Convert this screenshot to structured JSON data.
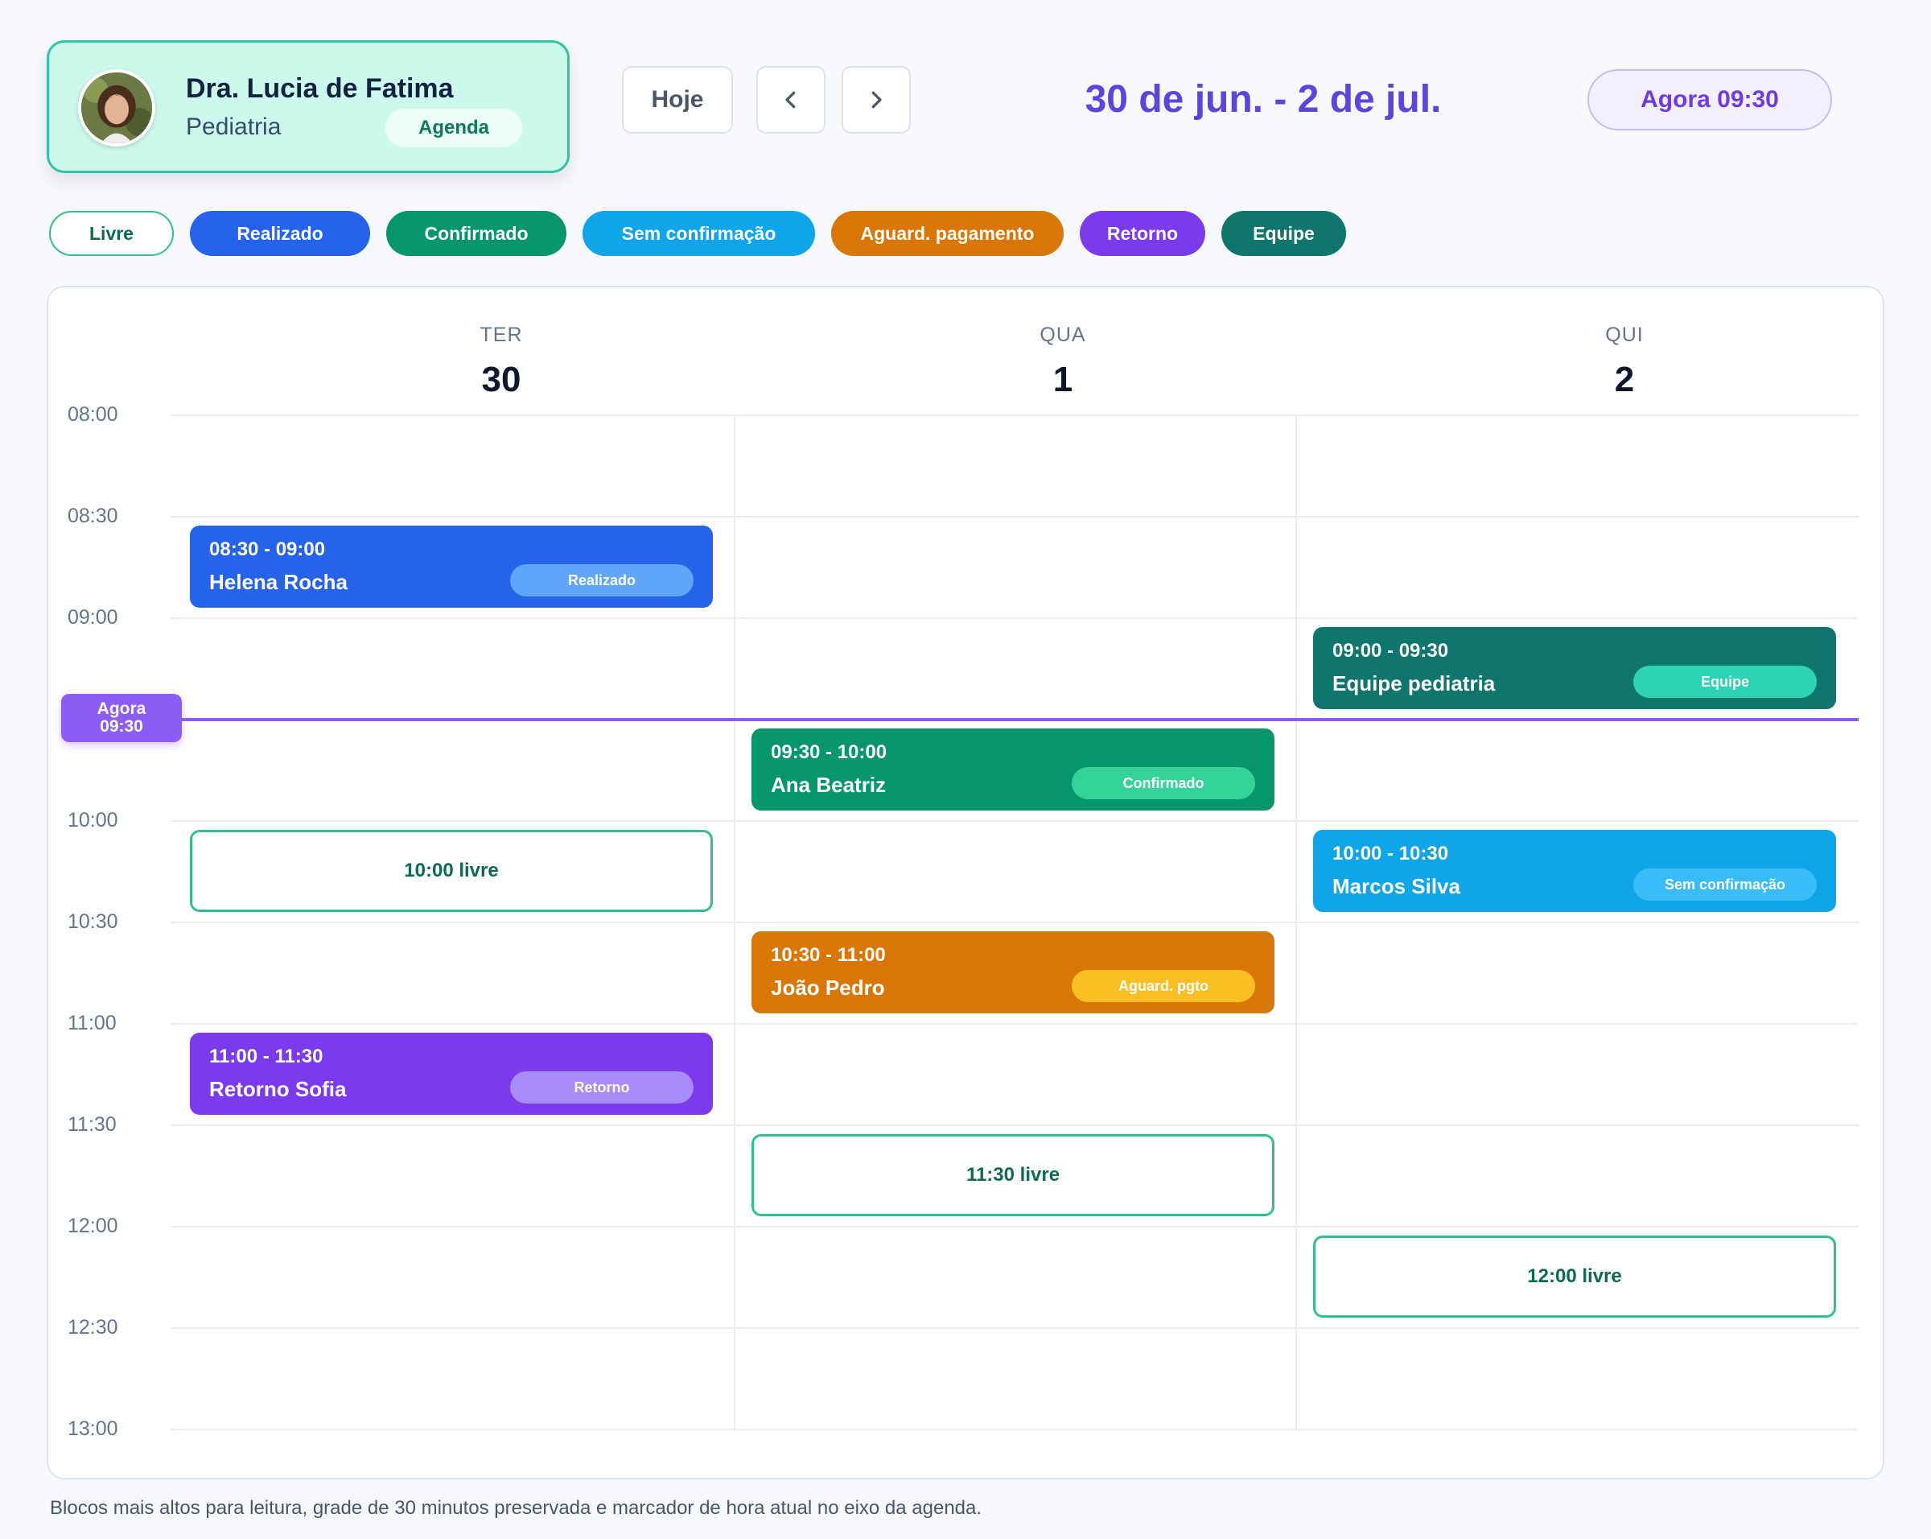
{
  "doctor": {
    "name": "Dra. Lucia de Fatima",
    "specialty": "Pediatria",
    "badge": "Agenda"
  },
  "toolbar": {
    "today_label": "Hoje",
    "prev_icon": "chevron-left-icon",
    "next_icon": "chevron-right-icon"
  },
  "range_title": "30 de jun. - 2 de jul.",
  "now_pill": "Agora 09:30",
  "legend": [
    {
      "label": "Livre",
      "color": "#ffffff",
      "border": "#2fc08f",
      "text": "#0b6b52"
    },
    {
      "label": "Realizado",
      "color": "#2563eb"
    },
    {
      "label": "Confirmado",
      "color": "#059669"
    },
    {
      "label": "Sem confirmação",
      "color": "#0ea5e9"
    },
    {
      "label": "Aguard. pagamento",
      "color": "#d97706"
    },
    {
      "label": "Retorno",
      "color": "#7c3aed"
    },
    {
      "label": "Equipe",
      "color": "#0f766e"
    }
  ],
  "days": [
    {
      "name": "TER",
      "num": "30"
    },
    {
      "name": "QUA",
      "num": "1"
    },
    {
      "name": "QUI",
      "num": "2"
    }
  ],
  "time_slots": [
    "08:00",
    "08:30",
    "09:00",
    "09:30",
    "10:00",
    "10:30",
    "11:00",
    "11:30",
    "12:00",
    "12:30",
    "13:00"
  ],
  "now_marker": {
    "line1": "Agora",
    "line2": "09:30",
    "time": "09:30"
  },
  "events": [
    {
      "day": 0,
      "start": "08:30",
      "time": "08:30 - 09:00",
      "name": "Helena Rocha",
      "badge": "Realizado",
      "color": "#2563eb",
      "badge_color": "#60a5fa"
    },
    {
      "day": 2,
      "start": "09:00",
      "time": "09:00 - 09:30",
      "name": "Equipe pediatria",
      "badge": "Equipe",
      "color": "#0f766e",
      "badge_color": "#2dd4b4"
    },
    {
      "day": 1,
      "start": "09:30",
      "time": "09:30 - 10:00",
      "name": "Ana Beatriz",
      "badge": "Confirmado",
      "color": "#059669",
      "badge_color": "#34d399"
    },
    {
      "day": 2,
      "start": "10:00",
      "time": "10:00 - 10:30",
      "name": "Marcos Silva",
      "badge": "Sem confirmação",
      "color": "#0ea5e9",
      "badge_color": "#38bdf8"
    },
    {
      "day": 1,
      "start": "10:30",
      "time": "10:30 - 11:00",
      "name": "João Pedro",
      "badge": "Aguard. pgto",
      "color": "#d97706",
      "badge_color": "#fbbf24"
    },
    {
      "day": 0,
      "start": "11:00",
      "time": "11:00 - 11:30",
      "name": "Retorno Sofia",
      "badge": "Retorno",
      "color": "#7c3aed",
      "badge_color": "#a78bfa"
    }
  ],
  "free_slots": [
    {
      "day": 0,
      "start": "10:00",
      "label": "10:00 livre"
    },
    {
      "day": 1,
      "start": "11:30",
      "label": "11:30 livre"
    },
    {
      "day": 2,
      "start": "12:00",
      "label": "12:00 livre"
    }
  ],
  "caption": "Blocos mais altos para leitura, grade de 30 minutos preservada e marcador de hora atual no eixo da agenda."
}
